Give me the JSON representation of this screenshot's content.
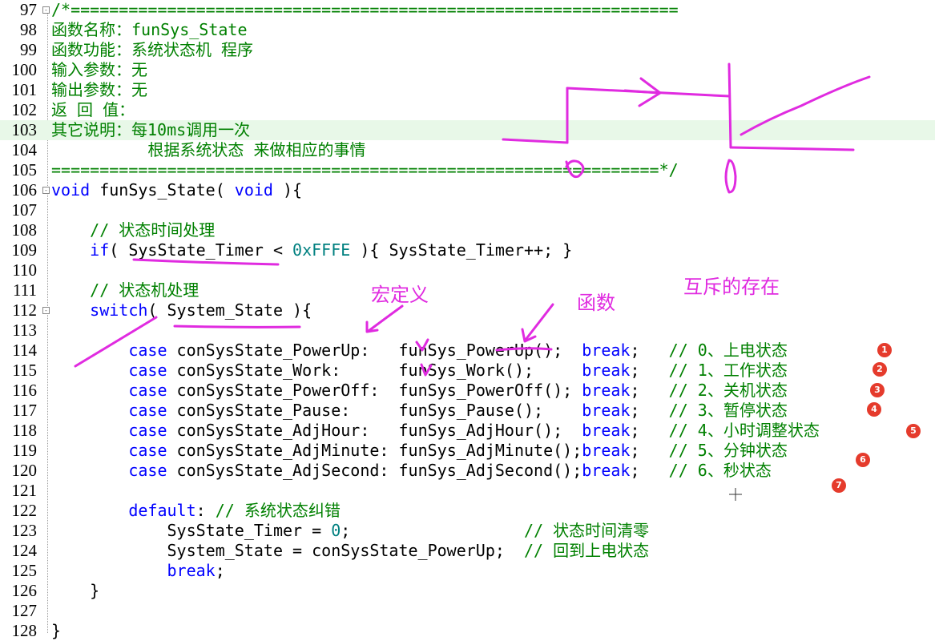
{
  "lines": [
    {
      "num": "97",
      "fold": "-",
      "tokens": [
        {
          "t": "/*===============================================================",
          "c": "cm"
        }
      ]
    },
    {
      "num": "98",
      "tokens": [
        {
          "t": "函数名称：funSys_State",
          "c": "cm"
        }
      ]
    },
    {
      "num": "99",
      "tokens": [
        {
          "t": "函数功能：系统状态机 程序",
          "c": "cm"
        }
      ]
    },
    {
      "num": "100",
      "tokens": [
        {
          "t": "输入参数：无",
          "c": "cm"
        }
      ]
    },
    {
      "num": "101",
      "tokens": [
        {
          "t": "输出参数：无",
          "c": "cm"
        }
      ]
    },
    {
      "num": "102",
      "tokens": [
        {
          "t": "返 回 值：",
          "c": "cm"
        }
      ]
    },
    {
      "num": "103",
      "hl": true,
      "tokens": [
        {
          "t": "其它说明：每10ms调用一次",
          "c": "cm"
        }
      ]
    },
    {
      "num": "104",
      "tokens": [
        {
          "t": "          根据系统状态 来做相应的事情",
          "c": "cm"
        }
      ]
    },
    {
      "num": "105",
      "tokens": [
        {
          "t": "===============================================================*/",
          "c": "cm"
        }
      ]
    },
    {
      "num": "106",
      "fold": "-",
      "tokens": [
        {
          "t": "void",
          "c": "kw"
        },
        {
          "t": " funSys_State( ",
          "c": "pl"
        },
        {
          "t": "void",
          "c": "kw"
        },
        {
          "t": " ){",
          "c": "pl"
        }
      ]
    },
    {
      "num": "107",
      "tokens": []
    },
    {
      "num": "108",
      "tokens": [
        {
          "t": "    // 状态时间处理",
          "c": "cm"
        }
      ]
    },
    {
      "num": "109",
      "tokens": [
        {
          "t": "    ",
          "c": "pl"
        },
        {
          "t": "if",
          "c": "kw"
        },
        {
          "t": "( SysState_Timer < ",
          "c": "pl"
        },
        {
          "t": "0xFFFE",
          "c": "num"
        },
        {
          "t": " ){ SysState_Timer++; }",
          "c": "pl"
        }
      ]
    },
    {
      "num": "110",
      "tokens": []
    },
    {
      "num": "111",
      "tokens": [
        {
          "t": "    // 状态机处理",
          "c": "cm"
        }
      ]
    },
    {
      "num": "112",
      "fold": "-",
      "tokens": [
        {
          "t": "    ",
          "c": "pl"
        },
        {
          "t": "switch",
          "c": "kw"
        },
        {
          "t": "( System_State ){",
          "c": "pl"
        }
      ]
    },
    {
      "num": "113",
      "tokens": []
    },
    {
      "num": "114",
      "tokens": [
        {
          "t": "        ",
          "c": "pl"
        },
        {
          "t": "case",
          "c": "kw"
        },
        {
          "t": " conSysState_PowerUp:   funSys_PowerUp();  ",
          "c": "pl"
        },
        {
          "t": "break",
          "c": "kw"
        },
        {
          "t": ";   ",
          "c": "pl"
        },
        {
          "t": "// 0、上电状态",
          "c": "cm"
        }
      ]
    },
    {
      "num": "115",
      "tokens": [
        {
          "t": "        ",
          "c": "pl"
        },
        {
          "t": "case",
          "c": "kw"
        },
        {
          "t": " conSysState_Work:      funSys_Work();     ",
          "c": "pl"
        },
        {
          "t": "break",
          "c": "kw"
        },
        {
          "t": ";   ",
          "c": "pl"
        },
        {
          "t": "// 1、工作状态",
          "c": "cm"
        }
      ]
    },
    {
      "num": "116",
      "tokens": [
        {
          "t": "        ",
          "c": "pl"
        },
        {
          "t": "case",
          "c": "kw"
        },
        {
          "t": " conSysState_PowerOff:  funSys_PowerOff(); ",
          "c": "pl"
        },
        {
          "t": "break",
          "c": "kw"
        },
        {
          "t": ";   ",
          "c": "pl"
        },
        {
          "t": "// 2、关机状态",
          "c": "cm"
        }
      ]
    },
    {
      "num": "117",
      "tokens": [
        {
          "t": "        ",
          "c": "pl"
        },
        {
          "t": "case",
          "c": "kw"
        },
        {
          "t": " conSysState_Pause:     funSys_Pause();    ",
          "c": "pl"
        },
        {
          "t": "break",
          "c": "kw"
        },
        {
          "t": ";   ",
          "c": "pl"
        },
        {
          "t": "// 3、暂停状态",
          "c": "cm"
        }
      ]
    },
    {
      "num": "118",
      "tokens": [
        {
          "t": "        ",
          "c": "pl"
        },
        {
          "t": "case",
          "c": "kw"
        },
        {
          "t": " conSysState_AdjHour:   funSys_AdjHour();  ",
          "c": "pl"
        },
        {
          "t": "break",
          "c": "kw"
        },
        {
          "t": ";   ",
          "c": "pl"
        },
        {
          "t": "// 4、小时调整状态",
          "c": "cm"
        }
      ]
    },
    {
      "num": "119",
      "tokens": [
        {
          "t": "        ",
          "c": "pl"
        },
        {
          "t": "case",
          "c": "kw"
        },
        {
          "t": " conSysState_AdjMinute: funSys_AdjMinute();",
          "c": "pl"
        },
        {
          "t": "break",
          "c": "kw"
        },
        {
          "t": ";   ",
          "c": "pl"
        },
        {
          "t": "// 5、分钟状态",
          "c": "cm"
        }
      ]
    },
    {
      "num": "120",
      "tokens": [
        {
          "t": "        ",
          "c": "pl"
        },
        {
          "t": "case",
          "c": "kw"
        },
        {
          "t": " conSysState_AdjSecond: funSys_AdjSecond();",
          "c": "pl"
        },
        {
          "t": "break",
          "c": "kw"
        },
        {
          "t": ";   ",
          "c": "pl"
        },
        {
          "t": "// 6、秒状态",
          "c": "cm"
        }
      ]
    },
    {
      "num": "121",
      "tokens": []
    },
    {
      "num": "122",
      "tokens": [
        {
          "t": "        ",
          "c": "pl"
        },
        {
          "t": "default",
          "c": "kw"
        },
        {
          "t": ": ",
          "c": "pl"
        },
        {
          "t": "// 系统状态纠错",
          "c": "cm"
        }
      ]
    },
    {
      "num": "123",
      "tokens": [
        {
          "t": "            SysState_Timer = ",
          "c": "pl"
        },
        {
          "t": "0",
          "c": "num"
        },
        {
          "t": ";                  ",
          "c": "pl"
        },
        {
          "t": "// 状态时间清零",
          "c": "cm"
        }
      ]
    },
    {
      "num": "124",
      "tokens": [
        {
          "t": "            System_State = conSysState_PowerUp;  ",
          "c": "pl"
        },
        {
          "t": "// 回到上电状态",
          "c": "cm"
        }
      ]
    },
    {
      "num": "125",
      "tokens": [
        {
          "t": "            ",
          "c": "pl"
        },
        {
          "t": "break",
          "c": "kw"
        },
        {
          "t": ";",
          "c": "pl"
        }
      ]
    },
    {
      "num": "126",
      "tokens": [
        {
          "t": "    }",
          "c": "pl"
        }
      ]
    },
    {
      "num": "127",
      "tokens": []
    },
    {
      "num": "128",
      "tokens": [
        {
          "t": "}",
          "c": "pl"
        }
      ]
    }
  ],
  "badges": [
    "1",
    "2",
    "3",
    "4",
    "5",
    "6",
    "7"
  ],
  "annotations": {
    "macro": "宏定义",
    "function": "函数",
    "mutex": "互斥的存在"
  },
  "colors": {
    "comment": "#008000",
    "keyword": "#0000ff",
    "number": "#008080",
    "highlight_line": "#e8f8e8",
    "ink": "#e02be0",
    "badge": "#e53b2c"
  }
}
